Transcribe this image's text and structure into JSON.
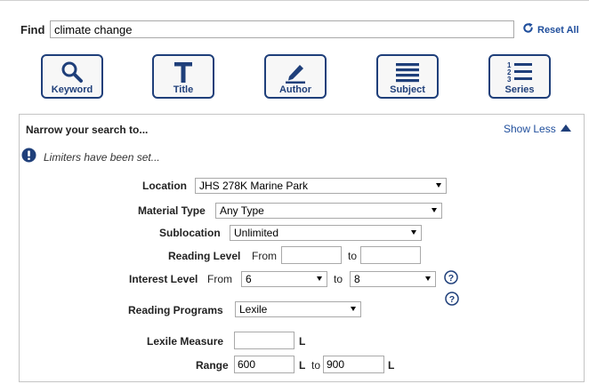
{
  "find": {
    "label": "Find",
    "value": "climate change",
    "reset_label": "Reset All"
  },
  "search_buttons": [
    {
      "label": "Keyword",
      "icon": "magnifier-icon"
    },
    {
      "label": "Title",
      "icon": "letter-t-icon"
    },
    {
      "label": "Author",
      "icon": "pen-icon"
    },
    {
      "label": "Subject",
      "icon": "lines-icon"
    },
    {
      "label": "Series",
      "icon": "numbered-list-icon"
    }
  ],
  "narrow": {
    "title": "Narrow your search to...",
    "toggle_label": "Show Less",
    "limiter_note": "Limiters have been set..."
  },
  "filters": {
    "location": {
      "label": "Location",
      "value": "JHS 278K Marine Park"
    },
    "material_type": {
      "label": "Material Type",
      "value": "Any Type"
    },
    "sublocation": {
      "label": "Sublocation",
      "value": "Unlimited"
    },
    "reading_level": {
      "label": "Reading Level",
      "from_label": "From",
      "to_label": "to",
      "from_value": "",
      "to_value": ""
    },
    "interest_level": {
      "label": "Interest Level",
      "from_label": "From",
      "to_label": "to",
      "from_value": "6",
      "to_value": "8"
    },
    "reading_programs": {
      "label": "Reading Programs",
      "value": "Lexile"
    },
    "lexile_measure": {
      "label": "Lexile Measure",
      "value": "",
      "unit": "L"
    },
    "range": {
      "label": "Range",
      "from_value": "600",
      "from_unit": "L",
      "to_label": "to",
      "to_value": "900",
      "to_unit": "L"
    }
  },
  "colors": {
    "accent": "#1f3f7a",
    "link": "#1f4e9c"
  }
}
